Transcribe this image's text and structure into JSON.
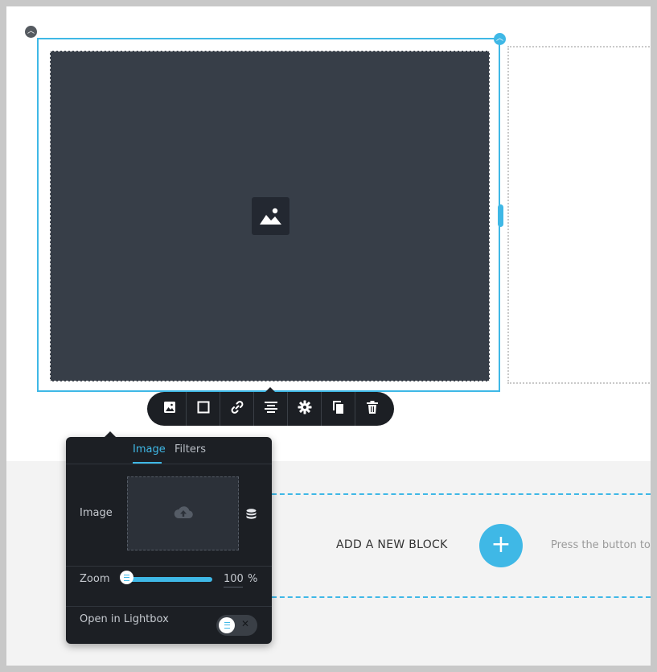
{
  "colors": {
    "accent": "#3fb8e6",
    "panel_bg": "#1c1f24",
    "image_placeholder_bg": "#373e48",
    "page_bg": "#ffffff",
    "lower_area_bg": "#f3f3f3"
  },
  "toolbar": {
    "buttons": [
      {
        "icon": "image-icon"
      },
      {
        "icon": "square-icon"
      },
      {
        "icon": "link-icon"
      },
      {
        "icon": "align-center-icon"
      },
      {
        "icon": "gear-icon"
      },
      {
        "icon": "duplicate-icon"
      },
      {
        "icon": "trash-icon"
      }
    ]
  },
  "panel": {
    "tabs": [
      {
        "label": "Image",
        "active": true
      },
      {
        "label": "Filters",
        "active": false
      }
    ],
    "image_label": "Image",
    "upload_icon": "cloud-upload-icon",
    "library_icon": "database-icon",
    "zoom_label": "Zoom",
    "zoom_value": "100",
    "zoom_unit": "%",
    "zoom_fraction": 1.0,
    "lightbox_label": "Open in Lightbox",
    "lightbox_enabled": false
  },
  "add_block": {
    "label": "ADD A NEW BLOCK",
    "button_icon": "plus-icon",
    "hint": "Press the button to"
  }
}
